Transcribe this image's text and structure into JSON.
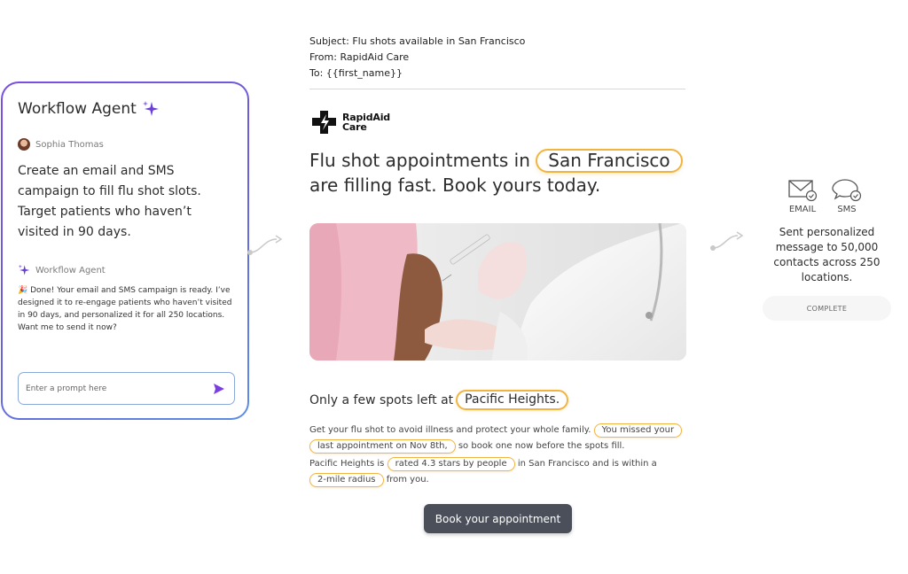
{
  "agent_panel": {
    "title": "Workflow Agent",
    "user_name": "Sophia Thomas",
    "user_message": "Create an email and SMS campaign to fill flu shot slots. Target patients who haven’t visited in 90 days.",
    "agent_name": "Workflow Agent",
    "agent_reply": "🎉 Done! Your email and SMS campaign is ready. I’ve designed it to re-engage patients who haven’t visited in 90 days, and personalized it for all 250 locations. Want me to send it now?",
    "prompt_placeholder": "Enter a prompt here",
    "accent_color": "#7a3fe0"
  },
  "email": {
    "subject_line": "Subject: Flu shots available in San Francisco",
    "from_line": "From: RapidAid Care",
    "to_line": "To: {{first_name}}",
    "logo_line1": "RapidAid",
    "logo_line2": "Care",
    "headline_part1": "Flu shot appointments in",
    "headline_city": "San Francisco",
    "headline_part2": "are filling fast. Book yours today.",
    "spots_text": "Only a few spots left at",
    "spots_location": "Pacific Heights.",
    "body1_text": "Get your flu shot to avoid illness and protect your whole family.",
    "body1_pill_a": "You missed your",
    "body1_pill_b": "last appointment on Nov 8th,",
    "body1_end": "so book one now before the spots fill.",
    "body2_start": "Pacific Heights is",
    "body2_pill_rating": "rated 4.3 stars by people",
    "body2_mid": "in San Francisco and is within a",
    "body2_pill_radius": "2-mile radius",
    "body2_end": "from you.",
    "cta_label": "Book your appointment",
    "highlight_color": "#f2b440"
  },
  "delivery": {
    "channel_email": "EMAIL",
    "channel_sms": "SMS",
    "summary": "Sent personalized message to 50,000 contacts across 250 locations.",
    "status": "COMPLETE"
  }
}
